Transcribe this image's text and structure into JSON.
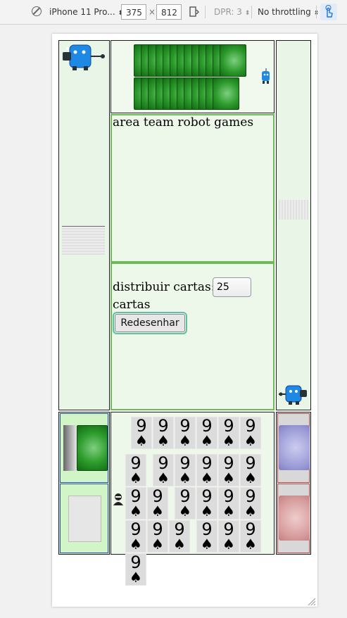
{
  "toolbar": {
    "device": "iPhone 11 Pro...",
    "width": "375",
    "times": "×",
    "height": "812",
    "dpr": "DPR: 3",
    "throttle": "No throttling",
    "caret": "⬍"
  },
  "game": {
    "area_title": "area team robot games",
    "deal_label": "distribuir cartas:",
    "deal_value": "25",
    "cards_word": "cartas",
    "redraw_label": "Redesenhar",
    "card_rank": "9",
    "card_suit": "♠"
  },
  "colors": {
    "accent_green": "#6dbb57",
    "card_back_green": "#2c9b2c",
    "robot_blue": "#1e88e5",
    "slot_blue": "#aaaadd",
    "slot_red": "#d59a9a"
  },
  "icons": [
    "no-entry-icon",
    "rotate-icon",
    "touch-icon",
    "robot-icon",
    "player-icon",
    "resize-icon"
  ]
}
